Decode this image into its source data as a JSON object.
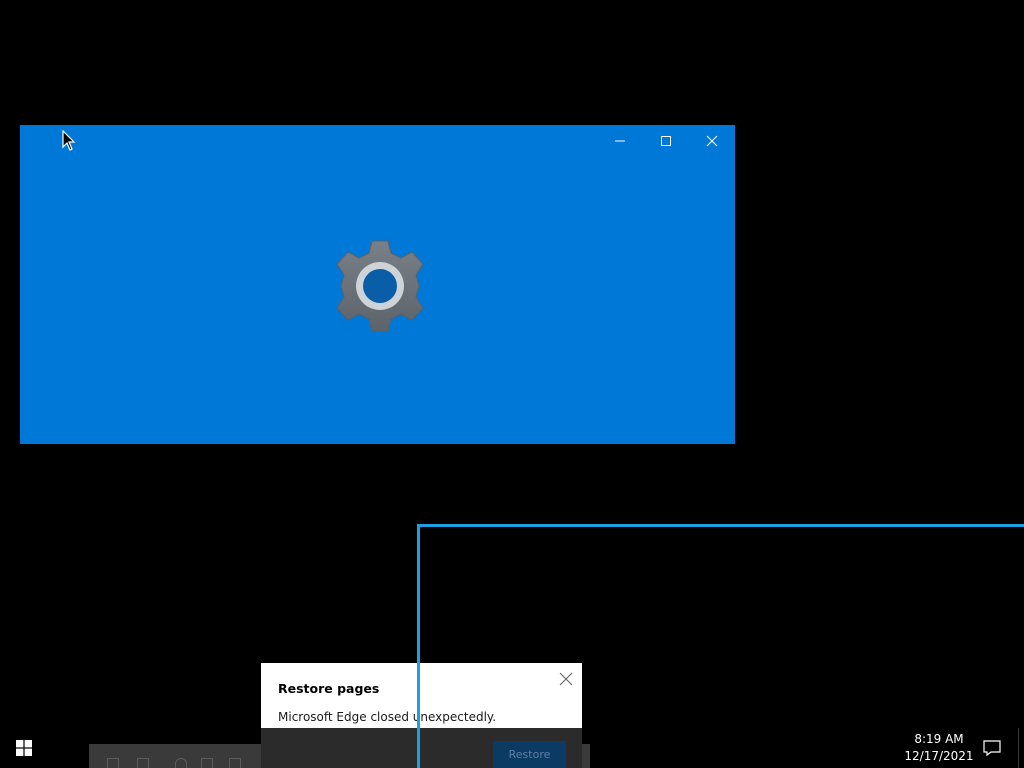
{
  "app_window": {
    "background_color": "#0078d7",
    "splash_icon": "gear-icon",
    "controls": {
      "minimize_icon": "minimize-icon",
      "maximize_icon": "maximize-icon",
      "close_icon": "close-icon"
    }
  },
  "restore_toast": {
    "title": "Restore pages",
    "message": "Microsoft Edge closed unexpectedly.",
    "button_label": "Restore",
    "close_icon": "close-icon"
  },
  "taskbar": {
    "start_icon": "windows-logo-icon",
    "time": "8:19 AM",
    "date": "12/17/2021",
    "action_center_icon": "notification-icon"
  },
  "accent_colors": {
    "focus_outline": "#1ba1e2",
    "window_blue": "#0078d7"
  }
}
